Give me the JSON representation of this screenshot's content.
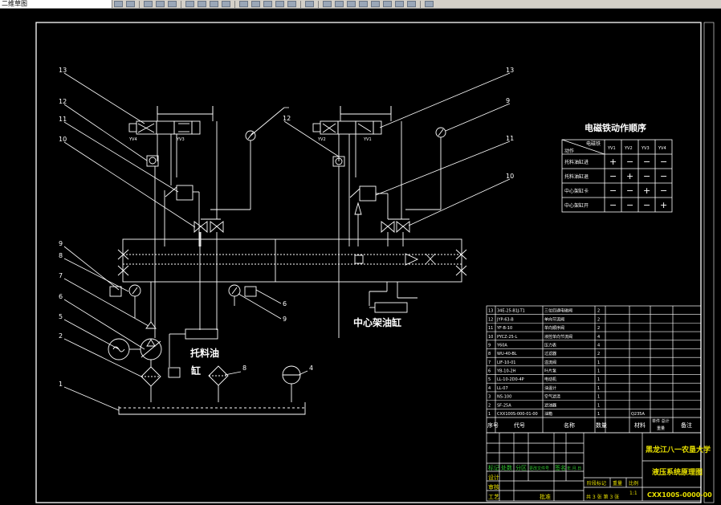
{
  "toolbar": {
    "workspace_label": "二维草图"
  },
  "drawing": {
    "labels": {
      "cylinder_left": "托料油",
      "cylinder_left_suffix": "缸",
      "cylinder_right": "中心架油缸",
      "valve_left_a": "YV4",
      "valve_left_b": "YV3",
      "valve_right_a": "YV2",
      "valve_right_b": "YV1"
    },
    "callouts": [
      "13",
      "12",
      "11",
      "10",
      "9",
      "8",
      "7",
      "6",
      "5",
      "2",
      "1",
      "13",
      "12",
      "11",
      "10",
      "9",
      "6",
      "9",
      "8",
      "4"
    ],
    "sequence_table": {
      "title": "电磁铁动作顺序",
      "header_corner": "动作",
      "header_corner_top": "电磁铁",
      "columns": [
        "YV1",
        "YV2",
        "YV3",
        "YV4"
      ],
      "rows": [
        {
          "name": "托料油缸进",
          "cells": [
            "+",
            "−",
            "−",
            "−"
          ]
        },
        {
          "name": "托料油缸退",
          "cells": [
            "−",
            "+",
            "−",
            "−"
          ]
        },
        {
          "name": "中心架缸卡",
          "cells": [
            "−",
            "−",
            "+",
            "−"
          ]
        },
        {
          "name": "中心架缸开",
          "cells": [
            "−",
            "−",
            "−",
            "+"
          ]
        }
      ]
    },
    "parts_list": {
      "rows": [
        {
          "no": "13",
          "code": "34E-25-B1J-T1",
          "name": "三位四通电磁阀",
          "qty": "2"
        },
        {
          "no": "12",
          "code": "JYP-63-B",
          "name": "单向节流阀",
          "qty": "2"
        },
        {
          "no": "11",
          "code": "YF-B-10",
          "name": "单向顺序阀",
          "qty": "2"
        },
        {
          "no": "10",
          "code": "PYCZ-25-L",
          "name": "液控单向节流阀",
          "qty": "4"
        },
        {
          "no": "9",
          "code": "Y60A",
          "name": "压力表",
          "qty": "4"
        },
        {
          "no": "8",
          "code": "WU-40-BL",
          "name": "过滤器",
          "qty": "2"
        },
        {
          "no": "7",
          "code": "LIF-10-01",
          "name": "溢流阀",
          "qty": "1"
        },
        {
          "no": "6",
          "code": "YB-10-2H",
          "name": "叶片泵",
          "qty": "1"
        },
        {
          "no": "5",
          "code": "LL-10-2D0-4P",
          "name": "电动机",
          "qty": "1"
        },
        {
          "no": "4",
          "code": "LL-07",
          "name": "油温计",
          "qty": "1"
        },
        {
          "no": "3",
          "code": "NS-100",
          "name": "空气滤清",
          "qty": "1"
        },
        {
          "no": "2",
          "code": "SF-25A",
          "name": "滤油器",
          "qty": "1"
        },
        {
          "no": "1",
          "code": "CXX100S-000-01-00",
          "name": "油箱",
          "qty": "1",
          "material": "Q235A"
        }
      ],
      "header": {
        "no": "序号",
        "code": "代号",
        "name": "名称",
        "qty": "数量",
        "material": "材料",
        "weight": "单件 总计",
        "weight_sub": "重量",
        "remark": "备注"
      }
    },
    "title_block": {
      "school": "黑龙江八一农垦大学",
      "drawing_title": "液压系统原理图",
      "drawing_no": "CXX100S-0000-00",
      "scale": "1:1",
      "sheet_info": "共 3 张   第 3 张",
      "rev_labels": [
        "标记",
        "处数",
        "分区",
        "更改文件号",
        "签名",
        "年.月.日"
      ],
      "sign_labels": [
        "设计",
        "审核",
        "工艺",
        "批准"
      ],
      "stage_labels": [
        "阶段标记",
        "重量",
        "比例"
      ]
    }
  }
}
